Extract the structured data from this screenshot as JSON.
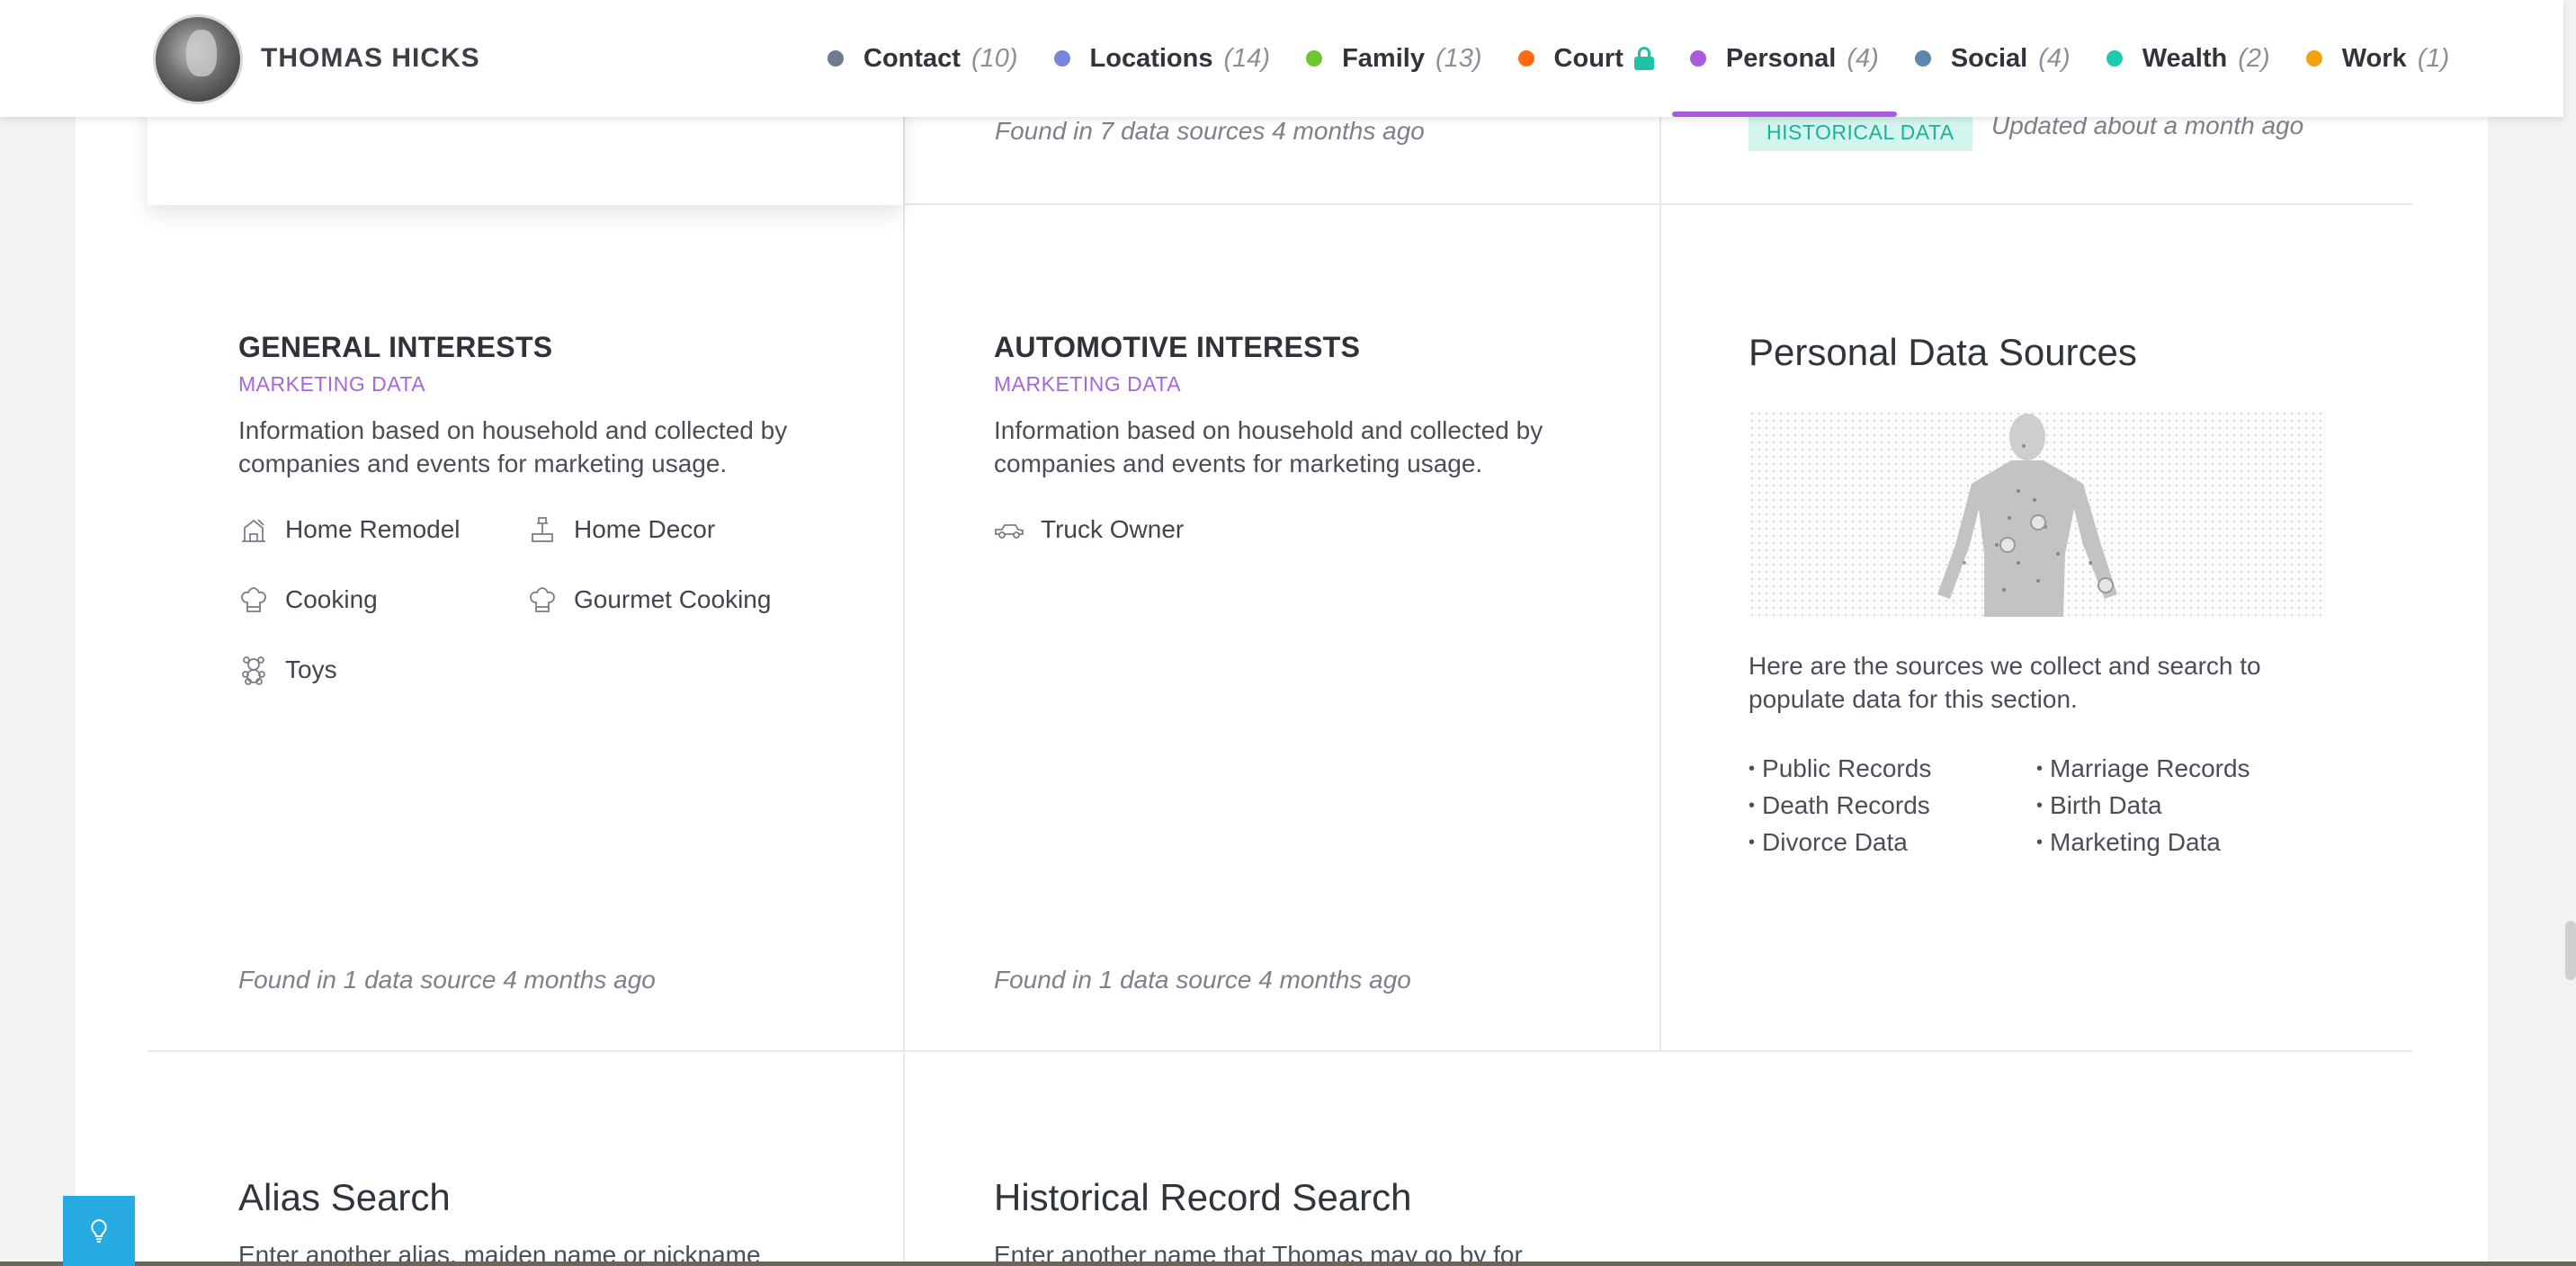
{
  "header": {
    "person_name": "THOMAS HICKS",
    "nav": [
      {
        "label": "Contact",
        "count": "(10)",
        "color": "#6f7c8c"
      },
      {
        "label": "Locations",
        "count": "(14)",
        "color": "#7b84db"
      },
      {
        "label": "Family",
        "count": "(13)",
        "color": "#6ec530"
      },
      {
        "label": "Court",
        "count": "",
        "color": "#ff6a13",
        "locked": true
      },
      {
        "label": "Personal",
        "count": "(4)",
        "color": "#a95bdb",
        "active": true
      },
      {
        "label": "Social",
        "count": "(4)",
        "color": "#5d87ad"
      },
      {
        "label": "Wealth",
        "count": "(2)",
        "color": "#1ec9b0"
      },
      {
        "label": "Work",
        "count": "(1)",
        "color": "#f2a20f"
      }
    ]
  },
  "top_row": {
    "middle_found": "Found in 7 data sources 4 months ago",
    "right_badge": "HISTORICAL DATA",
    "right_updated": "Updated about a month ago"
  },
  "general_interests": {
    "title": "GENERAL INTERESTS",
    "subtitle": "MARKETING DATA",
    "desc_line1": "Information based on household and collected by",
    "desc_line2": "companies and events for marketing usage.",
    "items": [
      {
        "label": "Home Remodel",
        "icon": "home-remodel-icon"
      },
      {
        "label": "Home Decor",
        "icon": "home-decor-icon"
      },
      {
        "label": "Cooking",
        "icon": "chef-hat-icon"
      },
      {
        "label": "Gourmet Cooking",
        "icon": "chef-hat-icon"
      },
      {
        "label": "Toys",
        "icon": "teddy-bear-icon"
      }
    ],
    "found": "Found in 1 data source 4 months ago"
  },
  "automotive_interests": {
    "title": "AUTOMOTIVE INTERESTS",
    "subtitle": "MARKETING DATA",
    "desc_line1": "Information based on household and collected by",
    "desc_line2": "companies and events for marketing usage.",
    "items": [
      {
        "label": "Truck Owner",
        "icon": "truck-icon"
      }
    ],
    "found": "Found in 1 data source 4 months ago"
  },
  "personal_data_sources": {
    "title": "Personal Data Sources",
    "desc_line1": "Here are the sources we collect and search to",
    "desc_line2": "populate data for this section.",
    "sources_left": [
      "Public Records",
      "Death Records",
      "Divorce Data"
    ],
    "sources_right": [
      "Marriage Records",
      "Birth Data",
      "Marketing Data"
    ]
  },
  "alias_search": {
    "title": "Alias Search",
    "desc": "Enter another alias, maiden name or nickname"
  },
  "historical_search": {
    "title": "Historical Record Search",
    "desc": "Enter another name that Thomas may go by for"
  }
}
